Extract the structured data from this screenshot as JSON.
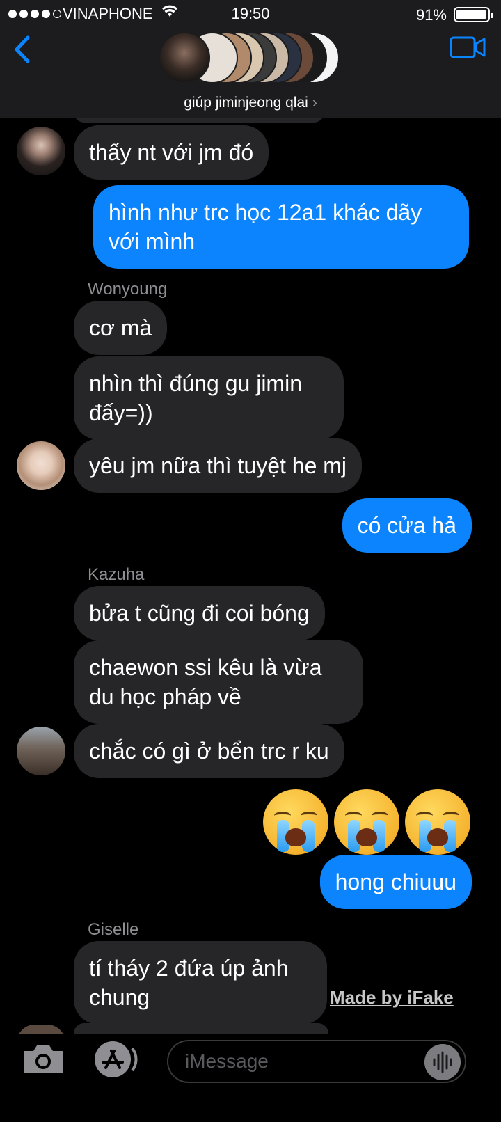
{
  "status": {
    "carrier": "VINAPHONE",
    "time": "19:50",
    "battery": "91%"
  },
  "header": {
    "group_name": "giúp jiminjeong qlai",
    "chevron": "›"
  },
  "messages": [
    {
      "text": "thấy nt với jm đó"
    },
    {
      "text": "hình như trc học 12a1 khác dãy với mình"
    },
    {
      "sender": "Wonyoung",
      "text": "cơ mà"
    },
    {
      "text": "nhìn thì đúng gu jimin đấy=))"
    },
    {
      "text": "yêu jm nữa thì tuyệt he mj"
    },
    {
      "text": "có cửa hả"
    },
    {
      "sender": "Kazuha",
      "text": "bửa t cũng đi coi bóng"
    },
    {
      "text": "chaewon ssi kêu là vừa du học pháp về"
    },
    {
      "text": "chắc có gì ở bển trc r ku"
    },
    {
      "emoji": [
        "loudly-crying-face",
        "loudly-crying-face",
        "loudly-crying-face"
      ]
    },
    {
      "text": "hong chiuuu"
    },
    {
      "sender": "Giselle",
      "text": "tí tháy 2 đứa úp ảnh chung"
    }
  ],
  "watermark": "Made by iFake",
  "input": {
    "placeholder": "iMessage"
  },
  "colors": {
    "outgoing": "#0b84fe",
    "incoming": "#262629",
    "accent": "#0a84ff"
  },
  "icons": [
    "back-chevron-icon",
    "video-call-icon",
    "camera-icon",
    "app-store-icon",
    "audio-waveform-icon",
    "wifi-icon",
    "battery-icon"
  ]
}
